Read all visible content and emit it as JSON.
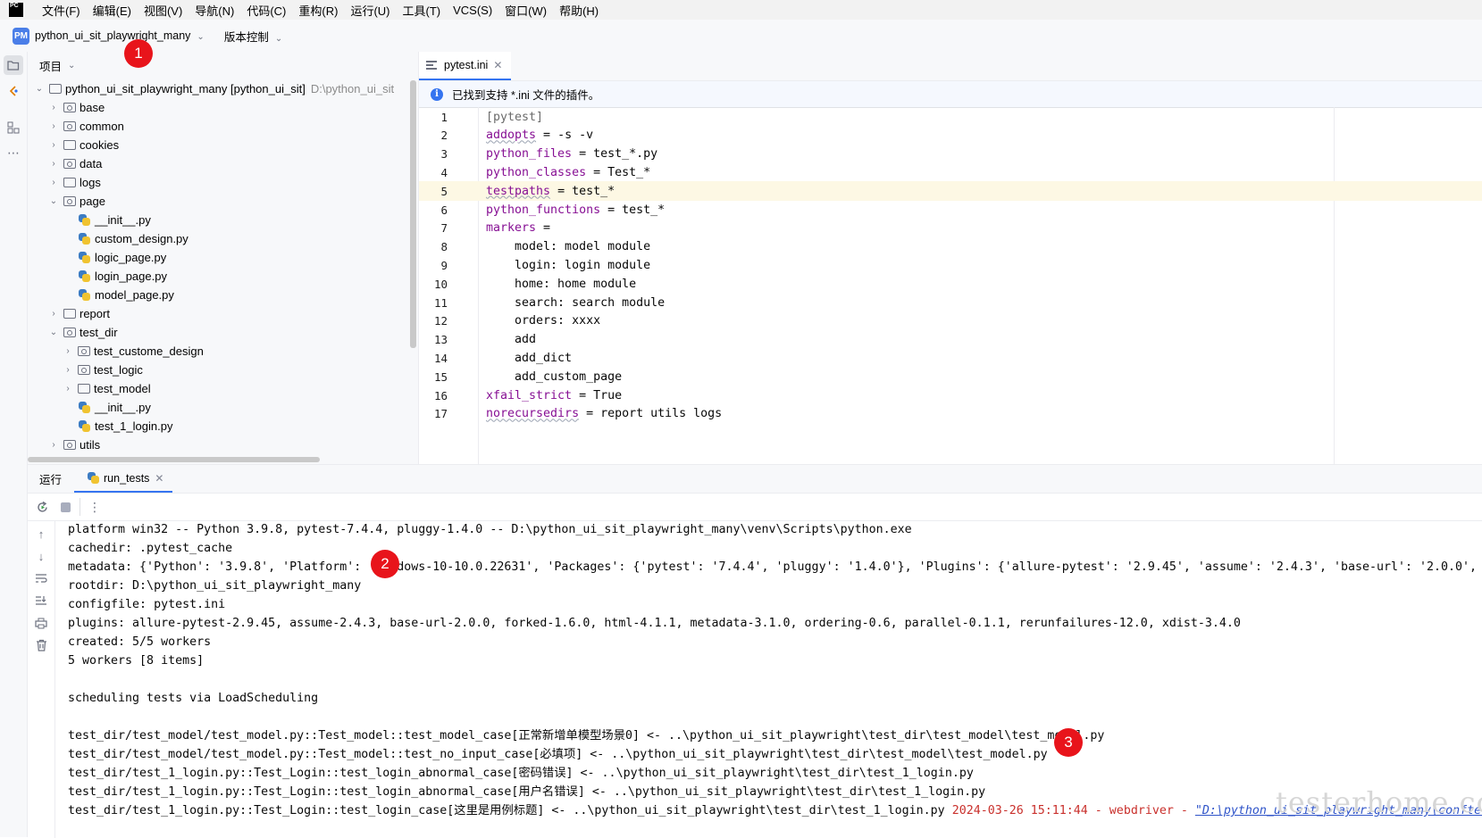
{
  "menubar": {
    "logo": "PC",
    "items": [
      "文件(F)",
      "编辑(E)",
      "视图(V)",
      "导航(N)",
      "代码(C)",
      "重构(R)",
      "运行(U)",
      "工具(T)",
      "VCS(S)",
      "窗口(W)",
      "帮助(H)"
    ]
  },
  "toolbar": {
    "project_badge": "PM",
    "project_name": "python_ui_sit_playwright_many",
    "vcs_label": "版本控制"
  },
  "project_panel": {
    "title": "项目",
    "root_name": "python_ui_sit_playwright_many [python_ui_sit]",
    "root_path": "D:\\python_ui_sit",
    "items": [
      {
        "label": "base",
        "type": "folder",
        "expanded": false
      },
      {
        "label": "common",
        "type": "folder",
        "expanded": false
      },
      {
        "label": "cookies",
        "type": "folder",
        "expanded": false
      },
      {
        "label": "data",
        "type": "folder",
        "expanded": false
      },
      {
        "label": "logs",
        "type": "folder",
        "expanded": false
      },
      {
        "label": "page",
        "type": "folder",
        "expanded": true
      },
      {
        "label": "__init__.py",
        "type": "py"
      },
      {
        "label": "custom_design.py",
        "type": "py"
      },
      {
        "label": "logic_page.py",
        "type": "py"
      },
      {
        "label": "login_page.py",
        "type": "py"
      },
      {
        "label": "model_page.py",
        "type": "py"
      },
      {
        "label": "report",
        "type": "folder",
        "expanded": false
      },
      {
        "label": "test_dir",
        "type": "folder",
        "expanded": true
      },
      {
        "label": "test_custome_design",
        "type": "folder",
        "expanded": false
      },
      {
        "label": "test_logic",
        "type": "folder",
        "expanded": false
      },
      {
        "label": "test_model",
        "type": "folder",
        "expanded": false
      },
      {
        "label": "__init__.py",
        "type": "py"
      },
      {
        "label": "test_1_login.py",
        "type": "py"
      },
      {
        "label": "utils",
        "type": "folder",
        "expanded": false
      }
    ]
  },
  "editor": {
    "tab_label": "pytest.ini",
    "banner_text": "已找到支持 *.ini 文件的插件。",
    "current_line": 5,
    "lines": [
      {
        "n": "1",
        "key": "",
        "rest": "[pytest]"
      },
      {
        "n": "2",
        "key": "addopts",
        "rest": " = -s -v"
      },
      {
        "n": "3",
        "key": "python_files",
        "rest": " = test_*.py"
      },
      {
        "n": "4",
        "key": "python_classes",
        "rest": " = Test_*"
      },
      {
        "n": "5",
        "key": "testpaths",
        "rest": " = test_*"
      },
      {
        "n": "6",
        "key": "python_functions",
        "rest": " = test_*"
      },
      {
        "n": "7",
        "key": "markers",
        "rest": " ="
      },
      {
        "n": "8",
        "key": "",
        "rest": "    model: model module"
      },
      {
        "n": "9",
        "key": "",
        "rest": "    login: login module"
      },
      {
        "n": "10",
        "key": "",
        "rest": "    home: home module"
      },
      {
        "n": "11",
        "key": "",
        "rest": "    search: search module"
      },
      {
        "n": "12",
        "key": "",
        "rest": "    orders: xxxx"
      },
      {
        "n": "13",
        "key": "",
        "rest": "    add"
      },
      {
        "n": "14",
        "key": "",
        "rest": "    add_dict"
      },
      {
        "n": "15",
        "key": "",
        "rest": "    add_custom_page"
      },
      {
        "n": "16",
        "key": "xfail_strict",
        "rest": " = True"
      },
      {
        "n": "17",
        "key": "norecursedirs",
        "rest": " = report utils logs"
      }
    ]
  },
  "run_panel": {
    "label": "运行",
    "tab_label": "run_tests",
    "console_lines": [
      "platform win32 -- Python 3.9.8, pytest-7.4.4, pluggy-1.4.0 -- D:\\python_ui_sit_playwright_many\\venv\\Scripts\\python.exe",
      "cachedir: .pytest_cache",
      "metadata: {'Python': '3.9.8', 'Platform': 'Windows-10-10.0.22631', 'Packages': {'pytest': '7.4.4', 'pluggy': '1.4.0'}, 'Plugins': {'allure-pytest': '2.9.45', 'assume': '2.4.3', 'base-url': '2.0.0',",
      "rootdir: D:\\python_ui_sit_playwright_many",
      "configfile: pytest.ini",
      "plugins: allure-pytest-2.9.45, assume-2.4.3, base-url-2.0.0, forked-1.6.0, html-4.1.1, metadata-3.1.0, ordering-0.6, parallel-0.1.1, rerunfailures-12.0, xdist-3.4.0",
      "created: 5/5 workers",
      "5 workers [8 items]",
      "",
      "scheduling tests via LoadScheduling",
      "",
      "test_dir/test_model/test_model.py::Test_model::test_model_case[正常新增单模型场景0] <- ..\\python_ui_sit_playwright\\test_dir\\test_model\\test_model.py",
      "test_dir/test_model/test_model.py::Test_model::test_no_input_case[必填项] <- ..\\python_ui_sit_playwright\\test_dir\\test_model\\test_model.py",
      "test_dir/test_1_login.py::Test_Login::test_login_abnormal_case[密码错误] <- ..\\python_ui_sit_playwright\\test_dir\\test_1_login.py",
      "test_dir/test_1_login.py::Test_Login::test_login_abnormal_case[用户名错误] <- ..\\python_ui_sit_playwright\\test_dir\\test_1_login.py"
    ],
    "last_line": {
      "text": "test_dir/test_1_login.py::Test_Login::test_login_case[这里是用例标题] <- ..\\python_ui_sit_playwright\\test_dir\\test_1_login.py ",
      "log": "2024-03-26 15:11:44 - webdriver - ",
      "link": "\"D:\\python_ui_sit_playwright_many\\conftes"
    }
  },
  "markers": [
    "1",
    "2",
    "3"
  ],
  "watermark": "testerhome.com",
  "colors": {
    "accent": "#3574f0",
    "marker_red": "#e8141b",
    "ini_key": "#871094",
    "current_line_bg": "#fdf8e4"
  }
}
